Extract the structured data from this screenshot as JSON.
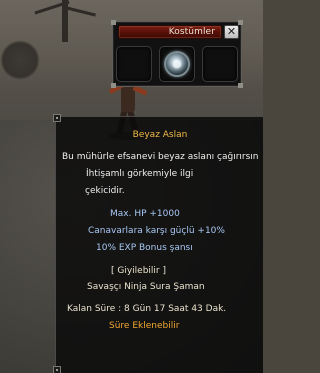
{
  "costume_window": {
    "title": "Kostümler",
    "close_glyph": "✕",
    "slots": [
      {
        "item_icon": null
      },
      {
        "item_icon": "seal-icon"
      },
      {
        "item_icon": null
      }
    ]
  },
  "tooltip": {
    "name": "Beyaz Aslan",
    "description_lines": [
      "Bu mühürle efsanevi beyaz aslanı çağırırsın",
      "İhtişamlı görkemiyle ilgi",
      "çekicidir."
    ],
    "bonuses": [
      "Max. HP +1000",
      "Canavarlara karşı güçlü +10%",
      "10% EXP Bonus şansı"
    ],
    "wearable": "[ Giyilebilir ]",
    "classes": "Savaşçı Ninja Sura Şaman",
    "remaining_time": "Kalan Süre : 8 Gün 17 Saat 43 Dak.",
    "extendable": "Süre Eklenebilir"
  },
  "colors": {
    "title_gold": "#f0b948",
    "bonus_blue": "#a8c8f4",
    "extendable_orange": "#f1a730",
    "titlebar_red": "#6a170d"
  }
}
